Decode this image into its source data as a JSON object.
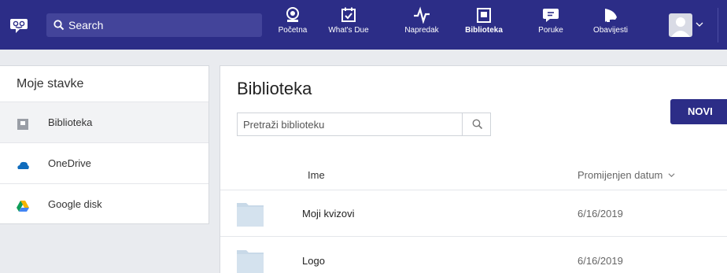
{
  "topbar": {
    "search_label": "Search",
    "nav": [
      {
        "label": "Početna",
        "icon": "home-icon"
      },
      {
        "label": "What's Due",
        "icon": "calendar-check-icon"
      },
      {
        "label": "Napredak",
        "icon": "pulse-icon"
      },
      {
        "label": "Biblioteka",
        "icon": "library-icon",
        "active": true
      },
      {
        "label": "Poruke",
        "icon": "chat-bubble-icon"
      },
      {
        "label": "Obavijesti",
        "icon": "megaphone-icon"
      }
    ],
    "accent_color": "#2c2d87"
  },
  "sidebar": {
    "title": "Moje stavke",
    "items": [
      {
        "label": "Biblioteka",
        "icon": "library-icon",
        "active": true
      },
      {
        "label": "OneDrive",
        "icon": "onedrive-icon"
      },
      {
        "label": "Google disk",
        "icon": "google-drive-icon"
      }
    ]
  },
  "main": {
    "title": "Biblioteka",
    "search_placeholder": "Pretraži biblioteku",
    "new_button": "NOVI",
    "columns": {
      "name": "Ime",
      "date": "Promijenjen datum"
    },
    "rows": [
      {
        "name": "Moji kvizovi",
        "date": "6/16/2019",
        "icon": "folder-icon"
      },
      {
        "name": "Logo",
        "date": "6/16/2019",
        "icon": "folder-icon"
      }
    ]
  }
}
